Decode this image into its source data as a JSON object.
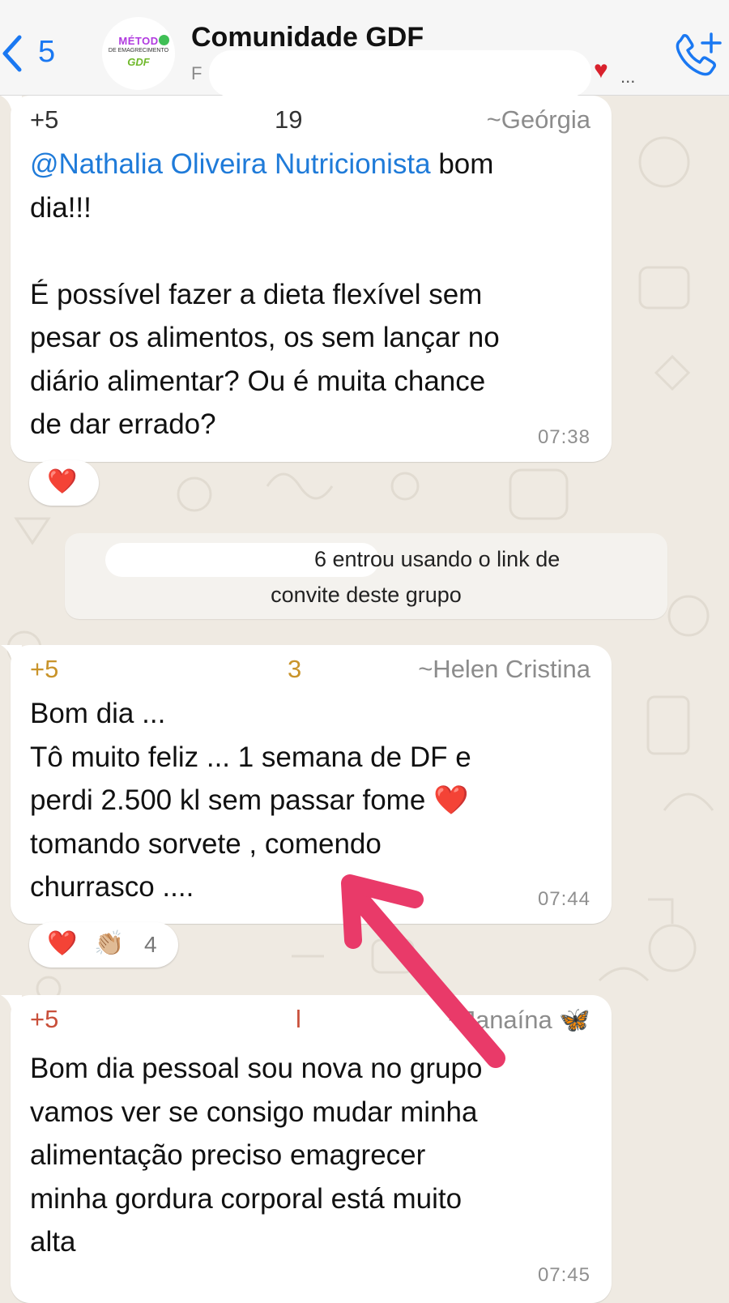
{
  "header": {
    "back_count": "5",
    "group_title": "Comunidade GDF",
    "subtitle_visible": "F",
    "subtitle_trailing": "...",
    "logo": {
      "line1": "MÉTOD",
      "line2": "DE EMAGRECIMENTO",
      "line3": "GDF"
    }
  },
  "messages": [
    {
      "phone_start": "+5",
      "phone_end": "19",
      "alias": "~Geórgia",
      "mention": "@Nathalia Oliveira Nutricionista",
      "text_line1_rest": " bom",
      "text_rest": "dia!!!\n\nÉ possível fazer a dieta flexível sem\npesar os alimentos, os sem lançar no\ndiário alimentar? Ou é muita chance\nde dar errado?",
      "time": "07:38",
      "reactions": [
        "❤️"
      ]
    },
    {
      "phone_start": "+5",
      "phone_end": "3",
      "alias": "~Helen Cristina",
      "text": "Bom dia ...\nTô muito feliz ... 1 semana de DF e\nperdi 2.500 kl sem passar fome ❤️\ntomando sorvete , comendo\nchurrasco ....",
      "time": "07:44",
      "reactions": [
        "❤️",
        "👏🏼"
      ],
      "reaction_count": "4"
    },
    {
      "phone_start": "+5",
      "phone_end": "l",
      "alias": "~Janaína",
      "alias_emoji": "🦋",
      "text": "Bom dia pessoal sou nova no grupo\nvamos ver se consigo mudar minha\nalimentação preciso emagrecer\nminha gordura corporal está muito\nalta",
      "time": "07:45"
    }
  ],
  "system_message": {
    "line1_visible_end": "6 entrou usando o link de",
    "line2": "convite deste grupo"
  },
  "colors": {
    "accent_blue": "#1a78f2",
    "mention_blue": "#1f7bd9",
    "phone_gold": "#c9942b",
    "phone_red": "#c9503b",
    "annotation_pink": "#e93a69",
    "chat_bg": "#efeae2"
  },
  "icons": {
    "back": "chevron-left-icon",
    "call": "add-call-icon"
  }
}
